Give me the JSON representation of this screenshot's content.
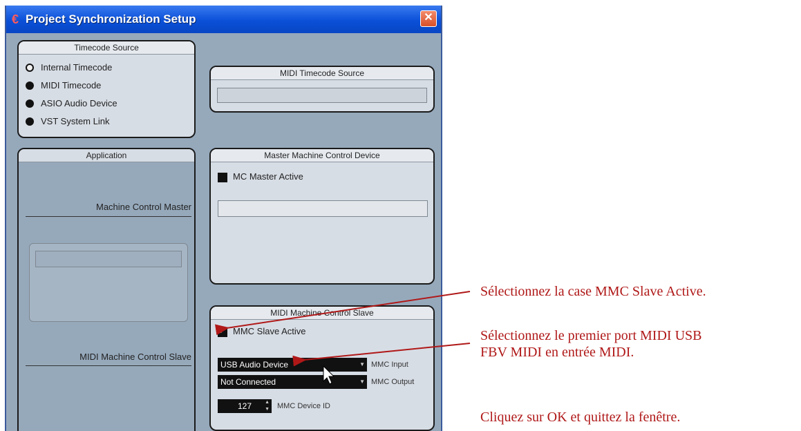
{
  "window": {
    "title": "Project Synchronization Setup"
  },
  "timecode_source": {
    "header": "Timecode Source",
    "options": [
      {
        "label": "Internal Timecode",
        "selected": true
      },
      {
        "label": "MIDI Timecode",
        "selected": false
      },
      {
        "label": "ASIO Audio Device",
        "selected": false
      },
      {
        "label": "VST System Link",
        "selected": false
      }
    ]
  },
  "midi_timecode_source": {
    "header": "MIDI Timecode Source",
    "value": ""
  },
  "application": {
    "header": "Application",
    "machine_control_master_label": "Machine Control Master",
    "midi_machine_control_slave_label": "MIDI Machine Control Slave"
  },
  "master_mc": {
    "header": "Master Machine Control Device",
    "checkbox_label": "MC Master Active",
    "checked": false
  },
  "mmc_slave": {
    "header": "MIDI Machine Control Slave",
    "checkbox_label": "MMC Slave Active",
    "checked": true,
    "input_value": "USB Audio Device",
    "input_label": "MMC Input",
    "output_value": "Not Connected",
    "output_label": "MMC Output",
    "device_id_value": "127",
    "device_id_label": "MMC Device ID"
  },
  "annotations": {
    "a1": "Sélectionnez la case MMC Slave Active.",
    "a2_line1": "Sélectionnez le premier port MIDI USB",
    "a2_line2": "FBV MIDI en entrée MIDI.",
    "a3": "Cliquez sur OK et quittez la fenêtre."
  },
  "colors": {
    "annotation": "#b01818",
    "titlebar": "#0a50d8"
  }
}
